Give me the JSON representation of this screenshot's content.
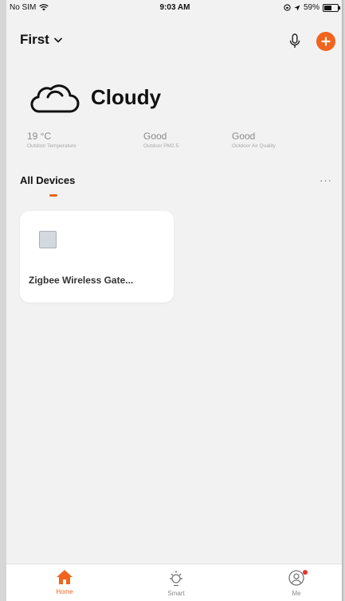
{
  "status_bar": {
    "carrier": "No SIM",
    "time": "9:03 AM",
    "battery": "59%",
    "battery_level": 0.59
  },
  "header": {
    "home_name": "First"
  },
  "weather": {
    "condition": "Cloudy",
    "stats": [
      {
        "value": "19 °C",
        "caption": "Outdoor Temperature"
      },
      {
        "value": "Good",
        "caption": "Outdoor PM2.5"
      },
      {
        "value": "Good",
        "caption": "Outdoor Air Quality"
      }
    ]
  },
  "devices": {
    "section_title": "All Devices",
    "more": "···",
    "items": [
      {
        "name": "Zigbee Wireless Gate..."
      }
    ]
  },
  "tabs": [
    {
      "label": "Home",
      "icon": "home-icon",
      "active": true
    },
    {
      "label": "Smart",
      "icon": "sun-icon",
      "active": false
    },
    {
      "label": "Me",
      "icon": "user-icon",
      "active": false
    }
  ],
  "colors": {
    "accent": "#f0641f",
    "background": "#f2f2f2",
    "badge": "#e8352a"
  }
}
